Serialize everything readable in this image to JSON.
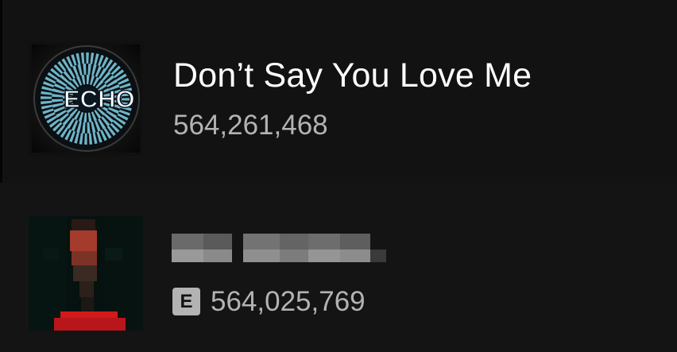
{
  "tracks": [
    {
      "title": "Don’t Say You Love Me",
      "plays": "564,261,468",
      "explicit": false,
      "artwork_text": "ECHO",
      "artwork_colors": [
        "#0d0d0d",
        "#6fb4c8",
        "#0a1620"
      ]
    },
    {
      "title_obscured": true,
      "plays": "564,025,769",
      "explicit": true,
      "explicit_label": "E",
      "artwork_obscured": true,
      "artwork_colors": [
        "#05100d",
        "#b03525",
        "#d61a1a"
      ]
    }
  ],
  "theme": {
    "background": "#121212",
    "primary_text": "#ffffff",
    "secondary_text": "#b3b3b3"
  }
}
